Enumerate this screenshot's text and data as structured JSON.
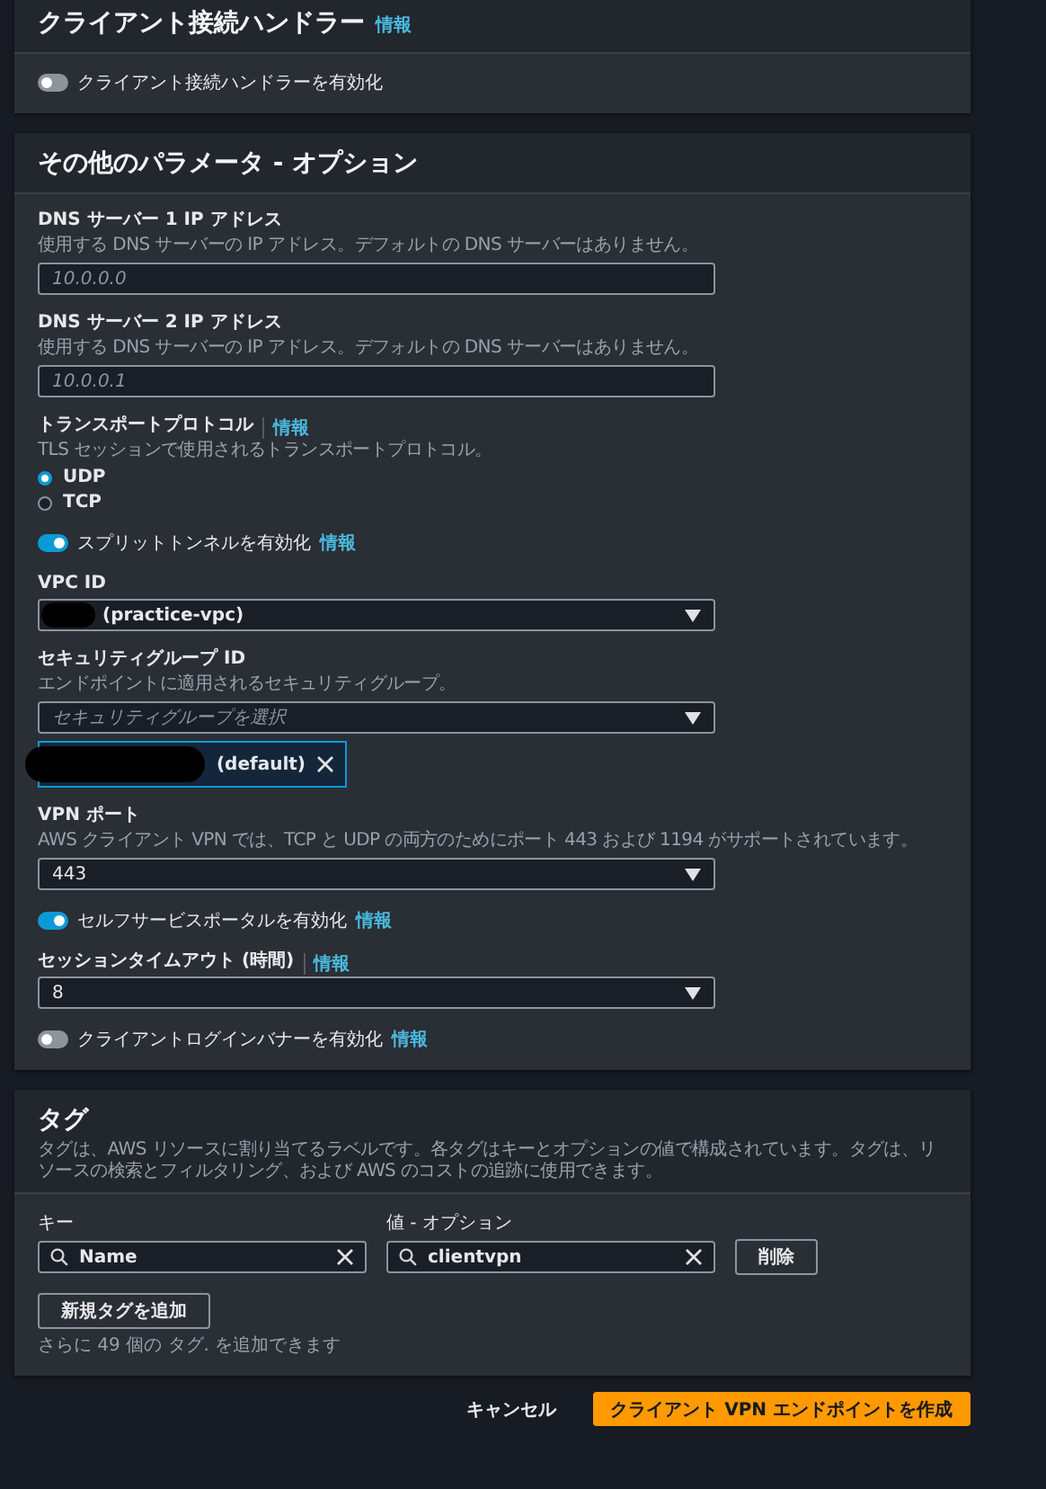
{
  "sections": [
    {
      "title": "クライアント接続ハンドラー",
      "info": "情報",
      "fields": [
        {
          "kind": "toggle",
          "label": "クライアント接続ハンドラーを有効化",
          "on": false
        }
      ]
    },
    {
      "title": "その他のパラメータ - オプション",
      "fields": [
        {
          "kind": "text",
          "label": "DNS サーバー 1 IP アドレス",
          "description": "使用する DNS サーバーの IP アドレス。デフォルトの DNS サーバーはありません。",
          "placeholder": "10.0.0.0"
        },
        {
          "kind": "text",
          "label": "DNS サーバー 2 IP アドレス",
          "description": "使用する DNS サーバーの IP アドレス。デフォルトの DNS サーバーはありません。",
          "placeholder": "10.0.0.1"
        },
        {
          "kind": "radio",
          "label": "トランスポートプロトコル",
          "info": "情報",
          "description": "TLS セッションで使用されるトランスポートプロトコル。",
          "options": [
            {
              "label": "UDP",
              "selected": true
            },
            {
              "label": "TCP",
              "selected": false
            }
          ]
        },
        {
          "kind": "toggle",
          "label": "スプリットトンネルを有効化",
          "info": "情報",
          "on": true
        },
        {
          "kind": "select",
          "label": "VPC ID",
          "value": "(practice-vpc)",
          "redacted": true
        },
        {
          "kind": "select",
          "label": "セキュリティグループ ID",
          "description": "エンドポイントに適用されるセキュリティグループ。",
          "placeholder": "セキュリティグループを選択",
          "tokens": [
            {
              "label": "(default)",
              "redacted": true
            }
          ]
        },
        {
          "kind": "select",
          "label": "VPN ポート",
          "description": "AWS クライアント VPN では、TCP と UDP の両方のためにポート 443 および 1194 がサポートされています。",
          "value": "443"
        },
        {
          "kind": "toggle",
          "label": "セルフサービスポータルを有効化",
          "info": "情報",
          "on": true
        },
        {
          "kind": "select",
          "label": "セッションタイムアウト (時間)",
          "info": "情報",
          "value": "8"
        },
        {
          "kind": "toggle",
          "label": "クライアントログインバナーを有効化",
          "info": "情報",
          "on": false
        }
      ]
    }
  ],
  "tags": {
    "title": "タグ",
    "description": "タグは、AWS リソースに割り当てるラベルです。各タグはキーとオプションの値で構成されています。タグは、リソースの検索とフィルタリング、および AWS のコストの追跡に使用できます。",
    "columns": [
      "キー",
      "値 - オプション"
    ],
    "rows": [
      {
        "key": "Name",
        "value": "clientvpn",
        "remove": "削除"
      }
    ],
    "add_button": "新規タグを追加",
    "hint": "さらに 49 個の タグ. を追加できます"
  },
  "footer": {
    "cancel": "キャンセル",
    "submit": "クライアント VPN エンドポイントを作成"
  }
}
